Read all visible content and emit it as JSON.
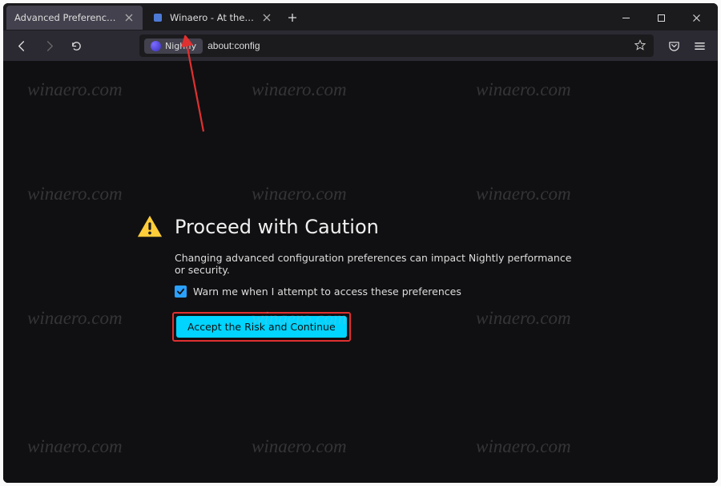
{
  "tabs": {
    "active": {
      "label": "Advanced Preferences"
    },
    "inactive": {
      "label": "Winaero - At the edge of tweak"
    }
  },
  "urlbar": {
    "identity_label": "Nightly",
    "url_value": "about:config"
  },
  "warning": {
    "title": "Proceed with Caution",
    "body": "Changing advanced configuration preferences can impact Nightly performance or security.",
    "checkbox_label": "Warn me when I attempt to access these preferences",
    "accept_label": "Accept the Risk and Continue"
  },
  "watermark": "winaero.com"
}
